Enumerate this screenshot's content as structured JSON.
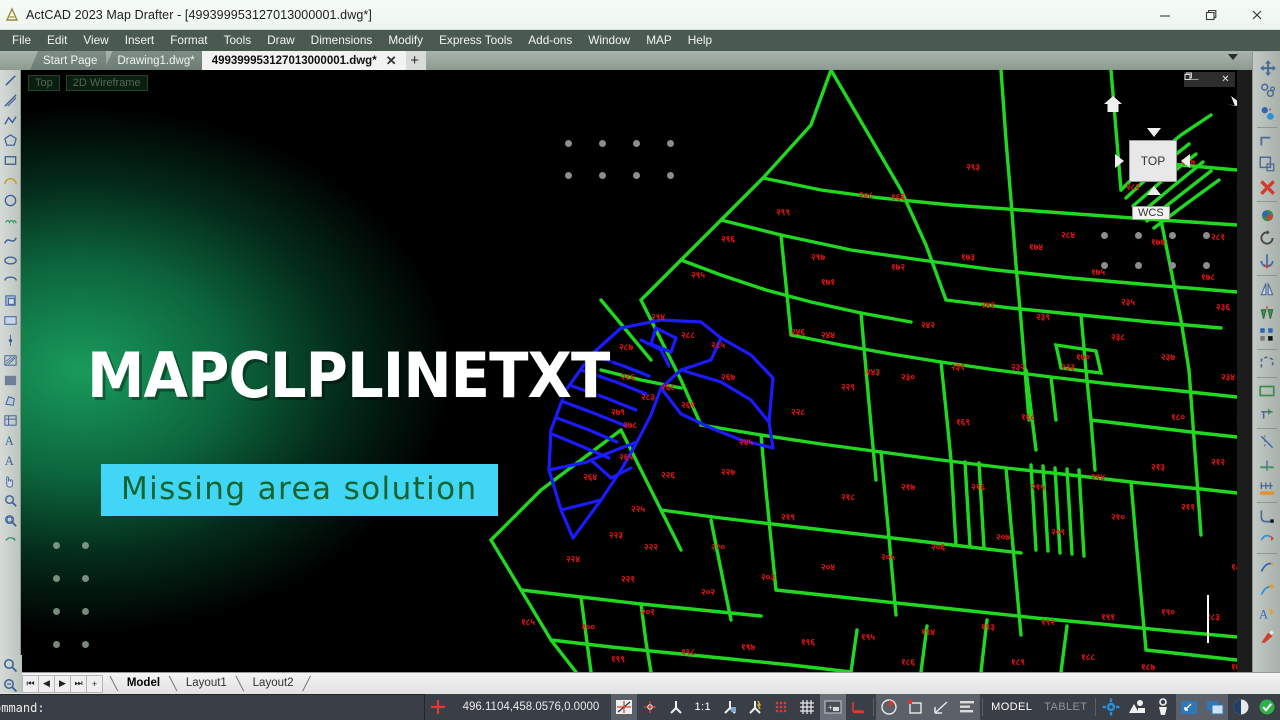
{
  "window": {
    "title": "ActCAD 2023 Map Drafter - [499399953127013000001.dwg*]",
    "app_icon": "actcad-icon",
    "minimize": "—",
    "maximize": "❐",
    "close": "✕"
  },
  "menu": {
    "items": [
      {
        "label": "File"
      },
      {
        "label": "Edit"
      },
      {
        "label": "View"
      },
      {
        "label": "Insert"
      },
      {
        "label": "Format"
      },
      {
        "label": "Tools"
      },
      {
        "label": "Draw"
      },
      {
        "label": "Dimensions"
      },
      {
        "label": "Modify"
      },
      {
        "label": "Express Tools"
      },
      {
        "label": "Add-ons"
      },
      {
        "label": "Window"
      },
      {
        "label": "MAP"
      },
      {
        "label": "Help"
      }
    ]
  },
  "tabs": {
    "items": [
      {
        "label": "Start Page",
        "active": false,
        "closeable": false
      },
      {
        "label": "Drawing1.dwg*",
        "active": false,
        "closeable": false
      },
      {
        "label": "499399953127013000001.dwg*",
        "active": true,
        "closeable": true
      }
    ],
    "close_glyph": "✕",
    "new_tab_glyph": "+"
  },
  "viewport": {
    "view_label": "Top",
    "visual_style_label": "2D Wireframe",
    "viewcube": {
      "face_label": "TOP",
      "ucs_label": "WCS",
      "home_icon": "home-icon"
    },
    "window_buttons": {
      "minimize": "—",
      "restore": "❐",
      "close": "✕"
    },
    "colors": {
      "background": "#000000",
      "parcel_green": "#21d821",
      "parcel_blue": "#1b1bff",
      "label_red": "#e81414"
    }
  },
  "promo": {
    "headline": "MAPCLPLINETXT",
    "subtitle": "Missing area solution",
    "subtitle_bg": "#41d6f5",
    "subtitle_fg": "#15642f",
    "overlay_color": "#0d7a46"
  },
  "layout_tabs": {
    "nav": [
      {
        "label": "⏮",
        "name": "first-layout-button"
      },
      {
        "label": "◀",
        "name": "previous-layout-button"
      },
      {
        "label": "▶",
        "name": "next-layout-button"
      },
      {
        "label": "⏭",
        "name": "last-layout-button"
      },
      {
        "label": "+",
        "name": "new-layout-button"
      }
    ],
    "items": [
      {
        "label": "Model",
        "active": true
      },
      {
        "label": "Layout1",
        "active": false
      },
      {
        "label": "Layout2",
        "active": false
      }
    ]
  },
  "command_line": {
    "prompt": "ommand:",
    "value": ""
  },
  "status_bar": {
    "coordinates": "496.1104,458.0576,0.0000",
    "scale": "1:1",
    "model_label": "MODEL",
    "tablet_label": "TABLET",
    "toggles": [
      {
        "name": "ortho-mode-icon",
        "label": ""
      },
      {
        "name": "snap-icon",
        "label": ""
      },
      {
        "name": "osnap-icon",
        "label": ""
      },
      {
        "name": "polar-tracking-icon",
        "label": ""
      },
      {
        "name": "otrack-icon",
        "label": ""
      },
      {
        "name": "snap-grid-icon",
        "label": ""
      },
      {
        "name": "grid-display-icon",
        "label": ""
      },
      {
        "name": "dynamic-input-icon",
        "label": ""
      },
      {
        "name": "lineweight-icon",
        "label": ""
      },
      {
        "name": "transparency-icon",
        "label": ""
      },
      {
        "name": "selection-cycling-icon",
        "label": ""
      },
      {
        "name": "annotation-scale-icon",
        "label": ""
      },
      {
        "name": "workspace-gear-icon",
        "label": ""
      },
      {
        "name": "hardware-acceleration-icon",
        "label": ""
      },
      {
        "name": "isolate-objects-icon",
        "label": ""
      },
      {
        "name": "clean-screen-icon",
        "label": ""
      },
      {
        "name": "window-layout-icon",
        "label": ""
      },
      {
        "name": "quick-properties-icon",
        "label": ""
      },
      {
        "name": "status-ok-icon",
        "label": ""
      }
    ]
  },
  "left_toolbar": {
    "items": [
      {
        "name": "line-tool"
      },
      {
        "name": "construction-line-tool"
      },
      {
        "name": "polyline-tool"
      },
      {
        "name": "polygon-tool"
      },
      {
        "name": "rectangle-tool"
      },
      {
        "name": "arc-tool"
      },
      {
        "name": "circle-tool"
      },
      {
        "name": "revision-cloud-tool"
      },
      {
        "name": "spline-tool"
      },
      {
        "name": "ellipse-tool"
      },
      {
        "name": "ellipse-arc-tool"
      },
      {
        "name": "insert-block-tool"
      },
      {
        "name": "make-block-tool"
      },
      {
        "name": "point-tool"
      },
      {
        "name": "hatch-tool"
      },
      {
        "name": "gradient-tool"
      },
      {
        "name": "region-tool"
      },
      {
        "name": "table-tool"
      },
      {
        "name": "multiline-text-tool"
      },
      {
        "name": "single-line-text-tool"
      },
      {
        "name": "pan-tool"
      },
      {
        "name": "zoom-window-tool"
      },
      {
        "name": "zoom-extents-tool"
      },
      {
        "name": "zoom-previous-tool"
      }
    ]
  },
  "right_toolbar": {
    "items": [
      {
        "name": "move-tool"
      },
      {
        "name": "copy-tool"
      },
      {
        "name": "mirror-blue-tool"
      },
      {
        "name": "offset-tool"
      },
      {
        "name": "array-tool"
      },
      {
        "name": "erase-tool"
      },
      {
        "name": "rotate-3d-tool"
      },
      {
        "name": "rotate-tool"
      },
      {
        "name": "align-tool"
      },
      {
        "name": "mirror-tool"
      },
      {
        "name": "scale-tool"
      },
      {
        "name": "array-rect-tool"
      },
      {
        "name": "stretch-tool"
      },
      {
        "name": "trim-tool"
      },
      {
        "name": "extend-tool"
      },
      {
        "name": "break-tool"
      },
      {
        "name": "join-tool"
      },
      {
        "name": "chamfer-tool"
      },
      {
        "name": "fillet-tool"
      },
      {
        "name": "explode-tool"
      },
      {
        "name": "edit-polyline-tool"
      },
      {
        "name": "edit-spline-tool"
      },
      {
        "name": "edit-text-tool"
      },
      {
        "name": "match-properties-tool"
      }
    ]
  }
}
